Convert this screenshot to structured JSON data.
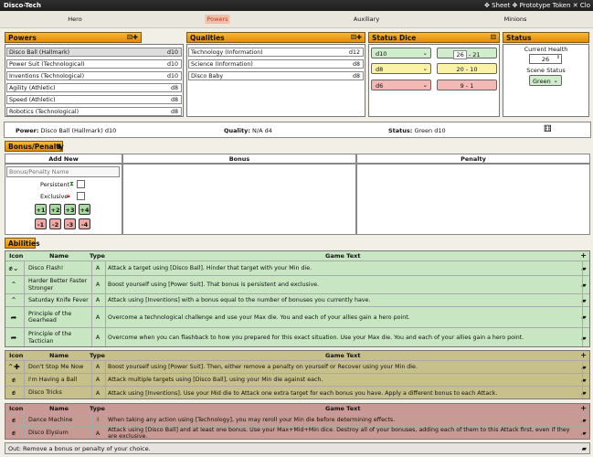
{
  "title_bar": {
    "title": "Disco-Tech",
    "right_links": "✥ Sheet ✥ Prototype Token ✕ Clo"
  },
  "tabs": [
    {
      "label": "Hero"
    },
    {
      "label": "Powers",
      "active": true
    },
    {
      "label": "Auxiliary"
    },
    {
      "label": "Minions"
    }
  ],
  "powers": {
    "header": "Powers",
    "items": [
      {
        "name": "Disco Ball (Hallmark)",
        "die": "d10",
        "selected": true
      },
      {
        "name": "Power Suit (Technological)",
        "die": "d10"
      },
      {
        "name": "Inventions (Technological)",
        "die": "d10"
      },
      {
        "name": "Agility (Athletic)",
        "die": "d8"
      },
      {
        "name": "Speed (Athletic)",
        "die": "d8"
      },
      {
        "name": "Robotics (Technological)",
        "die": "d8"
      }
    ]
  },
  "qualities": {
    "header": "Qualities",
    "items": [
      {
        "name": "Technology (Information)",
        "die": "d12"
      },
      {
        "name": "Science (Information)",
        "die": "d8"
      },
      {
        "name": "Disco Baby",
        "die": "d8"
      }
    ]
  },
  "status_dice": {
    "header": "Status Dice",
    "rows": [
      {
        "die": "d10",
        "range_a": "26",
        "range_b": "21",
        "color": "green"
      },
      {
        "die": "d8",
        "range": "20 - 10",
        "color": "yellow"
      },
      {
        "die": "d6",
        "range": "9 - 1",
        "color": "red"
      }
    ]
  },
  "status": {
    "header": "Status",
    "current_health_label": "Current Health",
    "current_health": "26",
    "scene_status_label": "Scene Status",
    "scene_status": "Green"
  },
  "summary": {
    "power_label": "Power:",
    "power_value": "Disco Ball (Hallmark) d10",
    "quality_label": "Quality:",
    "quality_value": "N/A d4",
    "status_label": "Status:",
    "status_value": "Green d10"
  },
  "bonus_penalty": {
    "header": "Bonus/Penalty",
    "add_new": "Add New",
    "bonus": "Bonus",
    "penalty": "Penalty",
    "name_placeholder": "Bonus/Penalty Name",
    "persistent": "Persistent",
    "exclusive": "Exclusive",
    "plus": [
      "+1",
      "+2",
      "+3",
      "+4"
    ],
    "minus": [
      "-1",
      "-2",
      "-3",
      "-4"
    ]
  },
  "abilities": {
    "header": "Abilities",
    "columns": {
      "icon": "Icon",
      "name": "Name",
      "type": "Type",
      "text": "Game Text"
    },
    "green": [
      {
        "icon": "fist-icon",
        "name": "Disco Flash!",
        "type": "A",
        "text": "Attack a target using [Disco Ball]. Hinder that target with your Min die."
      },
      {
        "icon": "boost-icon",
        "name": "Harder Better Faster Stronger",
        "type": "A",
        "text": "Boost yourself using [Power Suit]. That bonus is persistent and exclusive."
      },
      {
        "icon": "boost-icon",
        "name": "Saturday Knife Fever",
        "type": "A",
        "text": "Attack using [Inventions] with a bonus equal to the number of bonuses you currently have."
      },
      {
        "icon": "overcome-icon",
        "name": "Principle of the Gearhead",
        "type": "A",
        "text": "Overcome a technological challenge and use your Max die. You and each of your allies gain a hero point."
      },
      {
        "icon": "overcome-icon",
        "name": "Principle of the Tactician",
        "type": "A",
        "text": "Overcome when you can flashback to how you prepared for this exact situation. Use your Max die. You and each of your allies gain a hero point."
      }
    ],
    "yellow": [
      {
        "icon": "boost-icon",
        "name": "Don't Stop Me Now",
        "type": "A",
        "text": "Boost yourself using [Power Suit]. Then, either remove a penalty on yourself or Recover using your Min die."
      },
      {
        "icon": "fist-icon",
        "name": "I'm Having a Ball",
        "type": "A",
        "text": "Attack multiple targets using [Disco Ball], using your Min die against each."
      },
      {
        "icon": "fist-icon",
        "name": "Disco Tricks",
        "type": "A",
        "text": "Attack using [Inventions]. Use your Mid die to Attack one extra target for each bonus you have. Apply a different bonus to each Attack."
      }
    ],
    "red": [
      {
        "icon": "fist-icon",
        "name": "Dance Machine",
        "type": "I",
        "text": "When taking any action using [Technology], you may reroll your Min die before determining effects."
      },
      {
        "icon": "fist-icon",
        "name": "Disco Elysium",
        "type": "A",
        "text": "Attack using [Disco Ball] and at least one bonus. Use your Max+Mid+Min dice. Destroy all of your bonuses, adding each of them to this Attack first, even if they are exclusive."
      }
    ]
  },
  "out": "Out: Remove a bonus or penalty of your choice.",
  "colors": {
    "header": "#f0a020",
    "green": "#c8e6c2",
    "yellow": "#c8c08a",
    "red": "#c99a94"
  }
}
